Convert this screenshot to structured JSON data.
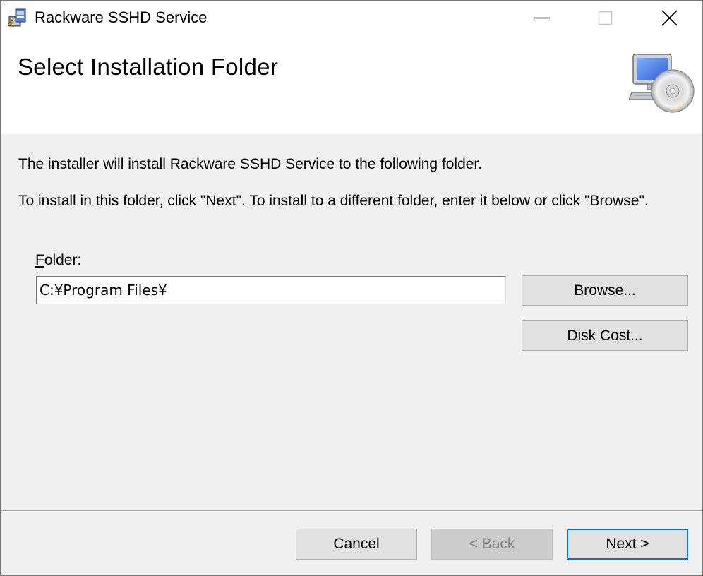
{
  "window": {
    "title": "Rackware SSHD Service"
  },
  "banner": {
    "title": "Select Installation Folder"
  },
  "body": {
    "line1": "The installer will install Rackware SSHD Service to the following folder.",
    "line2": "To install in this folder, click \"Next\". To install to a different folder, enter it below or click \"Browse\"."
  },
  "folder": {
    "label_mnemonic": "F",
    "label_rest": "older:",
    "value": "C:¥Program Files¥"
  },
  "buttons": {
    "browse": "Browse...",
    "disk_cost": "Disk Cost...",
    "cancel": "Cancel",
    "back": "< Back",
    "next": "Next >"
  },
  "icons": {
    "app": "installer-package-icon",
    "minimize": "minimize-icon",
    "maximize": "maximize-icon",
    "close": "close-icon",
    "banner": "computer-cd-icon"
  },
  "colors": {
    "accent": "#0078d7",
    "button_face": "#e1e1e1",
    "dialog_bg": "#f0f0f0"
  }
}
